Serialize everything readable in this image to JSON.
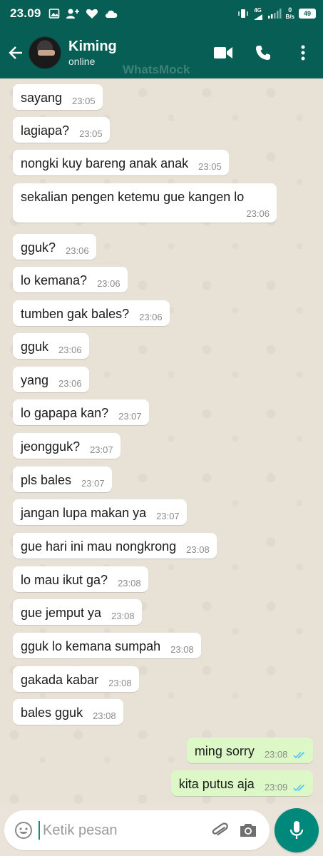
{
  "status_bar": {
    "time": "23.09",
    "network": "4G",
    "speed_value": "0",
    "speed_unit": "B/s",
    "battery": "49"
  },
  "header": {
    "contact_name": "Kiming",
    "contact_status": "online",
    "watermark": "WhatsMock"
  },
  "messages": [
    {
      "text": "sayang",
      "time": "23:05",
      "direction": "in"
    },
    {
      "text": "lagiapa?",
      "time": "23:05",
      "direction": "in"
    },
    {
      "text": "nongki kuy bareng anak anak",
      "time": "23:05",
      "direction": "in"
    },
    {
      "text": "sekalian pengen ketemu gue kangen lo",
      "time": "23:06",
      "direction": "in"
    },
    {
      "text": "gguk?",
      "time": "23:06",
      "direction": "in"
    },
    {
      "text": "lo kemana?",
      "time": "23:06",
      "direction": "in"
    },
    {
      "text": "tumben gak bales?",
      "time": "23:06",
      "direction": "in"
    },
    {
      "text": "gguk",
      "time": "23:06",
      "direction": "in"
    },
    {
      "text": "yang",
      "time": "23:06",
      "direction": "in"
    },
    {
      "text": "lo gapapa kan?",
      "time": "23:07",
      "direction": "in"
    },
    {
      "text": "jeongguk?",
      "time": "23:07",
      "direction": "in"
    },
    {
      "text": "pls bales",
      "time": "23:07",
      "direction": "in"
    },
    {
      "text": "jangan lupa makan ya",
      "time": "23:07",
      "direction": "in"
    },
    {
      "text": "gue hari ini mau nongkrong",
      "time": "23:08",
      "direction": "in"
    },
    {
      "text": "lo mau ikut ga?",
      "time": "23:08",
      "direction": "in"
    },
    {
      "text": "gue jemput ya",
      "time": "23:08",
      "direction": "in"
    },
    {
      "text": "gguk lo kemana sumpah",
      "time": "23:08",
      "direction": "in"
    },
    {
      "text": "gakada kabar",
      "time": "23:08",
      "direction": "in"
    },
    {
      "text": "bales gguk",
      "time": "23:08",
      "direction": "in"
    },
    {
      "text": "ming sorry",
      "time": "23:08",
      "direction": "out",
      "read": true
    },
    {
      "text": "kita putus aja",
      "time": "23:09",
      "direction": "out",
      "read": true
    }
  ],
  "input": {
    "placeholder": "Ketik pesan"
  },
  "icons": {
    "back": "arrow-left-icon",
    "video": "video-call-icon",
    "call": "phone-icon",
    "menu": "more-vert-icon",
    "emoji": "emoji-icon",
    "attach": "paperclip-icon",
    "camera": "camera-icon",
    "mic": "microphone-icon"
  },
  "colors": {
    "header": "#075e54",
    "outgoing_bubble": "#dcf8c6",
    "incoming_bubble": "#ffffff",
    "mic_button": "#00897b",
    "read_ticks": "#4fc3f7"
  }
}
